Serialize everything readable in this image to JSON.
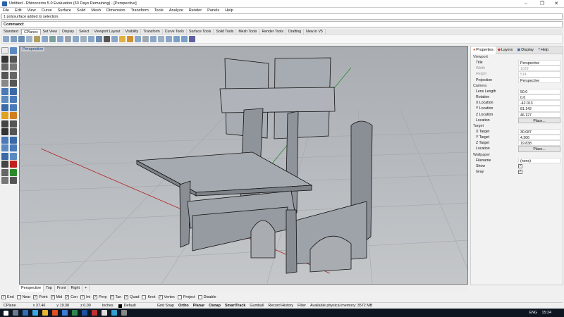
{
  "window": {
    "title": "Untitled - Rhinoceros 5.0 Evaluation (63 Days Remaining) - [Perspective]"
  },
  "menu": [
    "File",
    "Edit",
    "View",
    "Curve",
    "Surface",
    "Solid",
    "Mesh",
    "Dimension",
    "Transform",
    "Tools",
    "Analyze",
    "Render",
    "Panels",
    "Help"
  ],
  "command": {
    "history": "1 polysurface added to selection.",
    "prompt": "Command:"
  },
  "toolbar_tabs": [
    "Standard",
    "CPlanes",
    "Set View",
    "Display",
    "Select",
    "Viewport Layout",
    "Visibility",
    "Transform",
    "Curve Tools",
    "Surface Tools",
    "Solid Tools",
    "Mesh Tools",
    "Render Tools",
    "Drafting",
    "New in V5"
  ],
  "viewport": {
    "label": "Perspective"
  },
  "viewport_tabs": [
    "Perspective",
    "Top",
    "Front",
    "Right",
    "+"
  ],
  "panel": {
    "tabs": [
      "Properties",
      "Layers",
      "Display",
      "Help"
    ],
    "viewport_section": "Viewport",
    "title_label": "Title",
    "title_value": "Perspective",
    "width_label": "Width",
    "width_value": "1029",
    "height_label": "Height",
    "height_value": "514",
    "projection_label": "Projection",
    "projection_value": "Perspective",
    "camera_section": "Camera",
    "lens_label": "Lens Length",
    "lens_value": "50.0",
    "rotation_label": "Rotation",
    "rotation_value": "0.0",
    "xloc_label": "X Location",
    "xloc_value": "-42.013",
    "yloc_label": "Y Location",
    "yloc_value": "81.142",
    "zloc_label": "Z Location",
    "zloc_value": "46.127",
    "location_label": "Location",
    "place_button": "Place...",
    "target_section": "Target",
    "xtgt_label": "X Target",
    "xtgt_value": "30.087",
    "ytgt_label": "Y Target",
    "ytgt_value": "4.206",
    "ztgt_label": "Z Target",
    "ztgt_value": "19.838",
    "tloc_label": "Location",
    "tplace_button": "Place...",
    "wallpaper_section": "Wallpaper",
    "filename_label": "Filename",
    "filename_value": "(none)",
    "show_label": "Show",
    "gray_label": "Gray"
  },
  "osnap": [
    {
      "label": "End",
      "checked": true
    },
    {
      "label": "Near",
      "checked": false
    },
    {
      "label": "Point",
      "checked": true
    },
    {
      "label": "Mid",
      "checked": true
    },
    {
      "label": "Cen",
      "checked": true
    },
    {
      "label": "Int",
      "checked": true
    },
    {
      "label": "Perp",
      "checked": true
    },
    {
      "label": "Tan",
      "checked": true
    },
    {
      "label": "Quad",
      "checked": true
    },
    {
      "label": "Knot",
      "checked": false
    },
    {
      "label": "Vertex",
      "checked": true
    },
    {
      "label": "Project",
      "checked": false
    },
    {
      "label": "Disable",
      "checked": false
    }
  ],
  "status": {
    "cplane": "CPlane",
    "x": "x 37.46",
    "y": "y 19.38",
    "z": "z 0.00",
    "units": "Inches",
    "layer": "Default",
    "grid_snap": "Grid Snap",
    "ortho": "Ortho",
    "planar": "Planar",
    "osnap": "Osnap",
    "smarttrack": "SmartTrack",
    "gumball": "Gumball",
    "record_history": "Record History",
    "filter": "Filter",
    "memory": "Available physical memory: 3572 MB"
  },
  "taskbar": {
    "clock": "15:24",
    "lang": "ENG"
  },
  "colors": {
    "accent": "#0b3d91",
    "viewport_top": "#a9adb2",
    "viewport_bottom": "#c4c7ca",
    "taskbar": "#0e1621"
  }
}
